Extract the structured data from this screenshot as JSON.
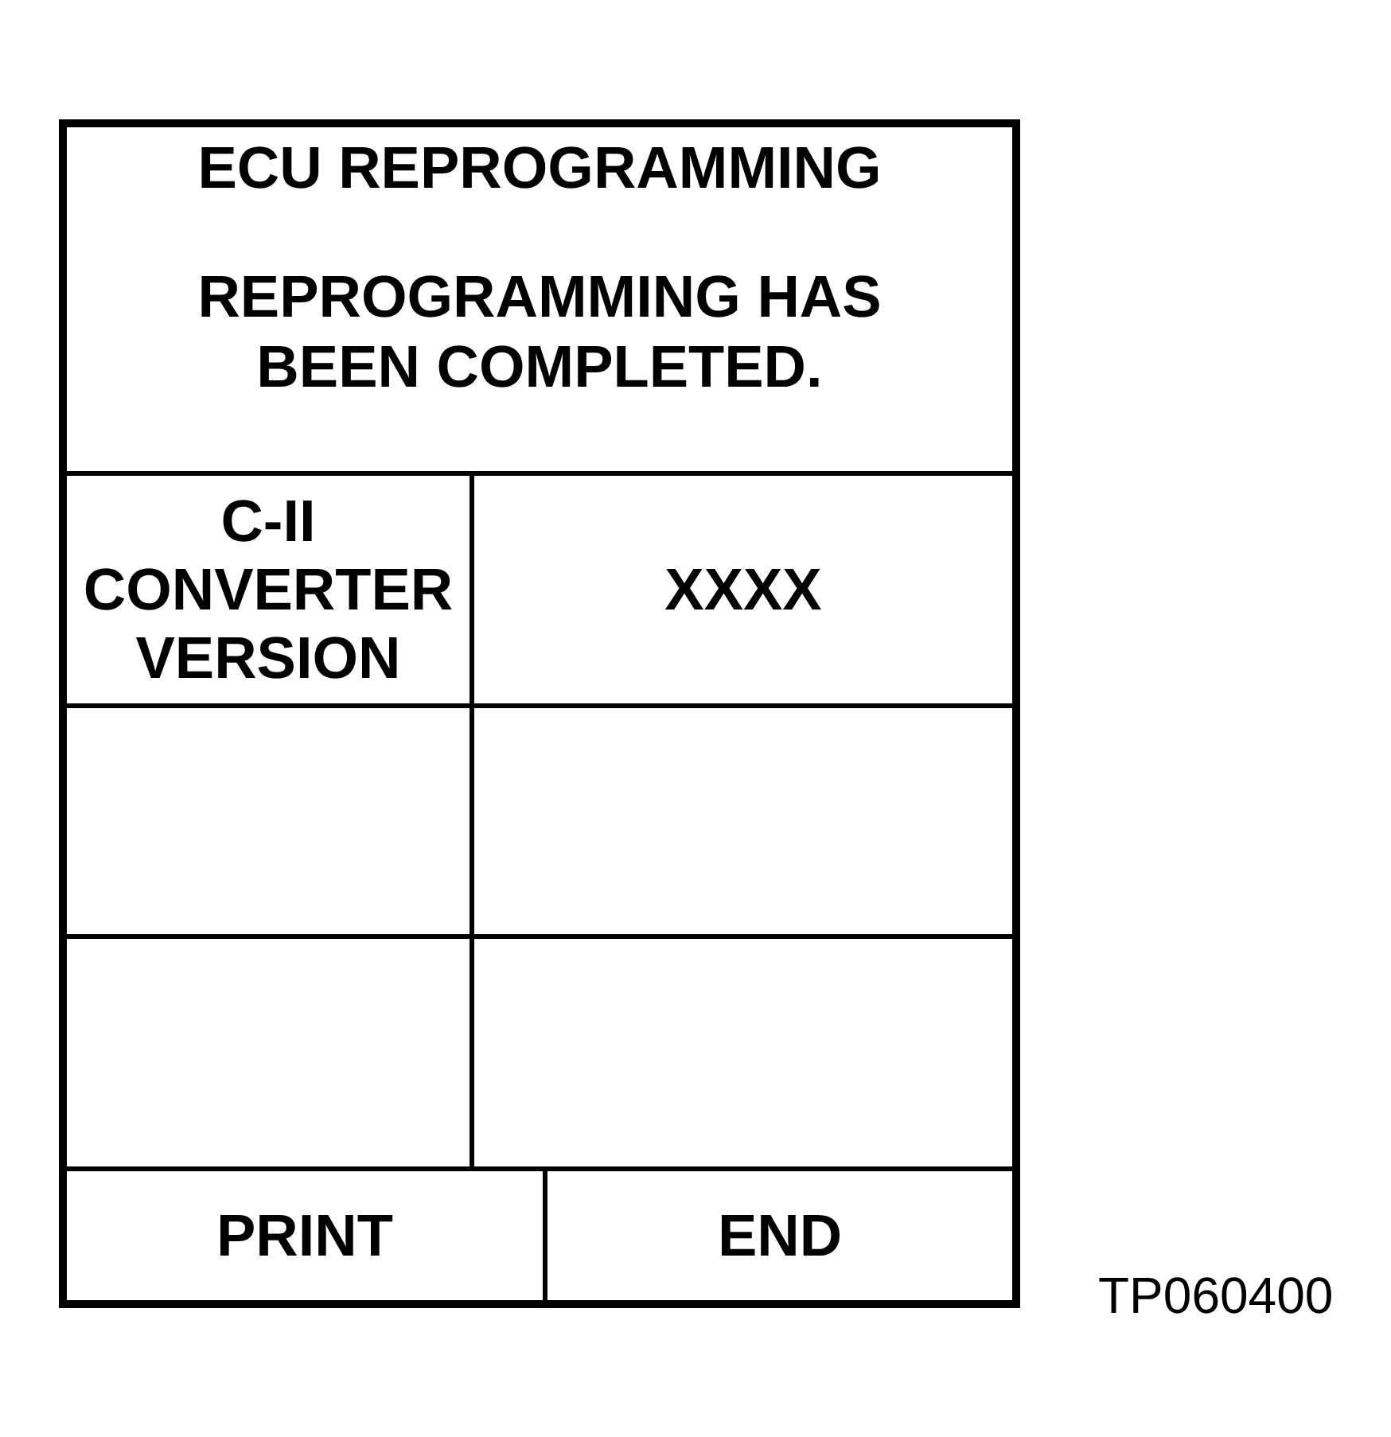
{
  "screen": {
    "title": "ECU REPROGRAMMING",
    "message": "REPROGRAMMING HAS BEEN COMPLETED.",
    "rows": [
      {
        "kind": "entry",
        "label": "C-II CONVERTER VERSION",
        "value": "XXXX"
      },
      {
        "kind": "blank"
      },
      {
        "kind": "blank"
      }
    ],
    "buttons": [
      "PRINT",
      "END"
    ]
  },
  "figure_code": "TP060400"
}
